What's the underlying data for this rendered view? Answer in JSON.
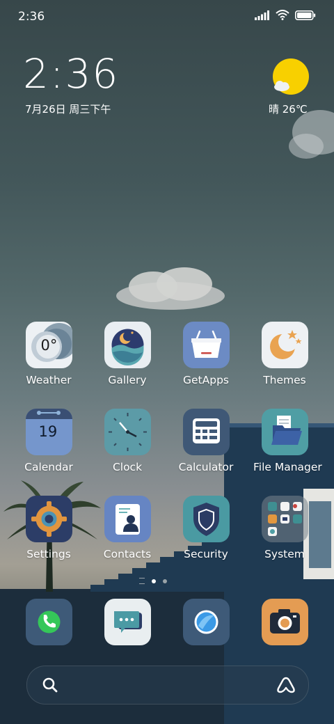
{
  "status_bar": {
    "time": "2:36"
  },
  "widget": {
    "time": "2:36",
    "date": "7月26日 周三下午",
    "weather": "晴 26℃"
  },
  "apps": [
    {
      "label": "Weather",
      "icon": "weather-icon",
      "badge": "0°"
    },
    {
      "label": "Gallery",
      "icon": "gallery-icon"
    },
    {
      "label": "GetApps",
      "icon": "getapps-icon"
    },
    {
      "label": "Themes",
      "icon": "themes-icon"
    },
    {
      "label": "Calendar",
      "icon": "calendar-icon",
      "badge": "19"
    },
    {
      "label": "Clock",
      "icon": "clock-icon"
    },
    {
      "label": "Calculator",
      "icon": "calculator-icon"
    },
    {
      "label": "File Manager",
      "icon": "file-manager-icon"
    },
    {
      "label": "Settings",
      "icon": "settings-icon"
    },
    {
      "label": "Contacts",
      "icon": "contacts-icon"
    },
    {
      "label": "Security",
      "icon": "security-icon"
    },
    {
      "label": "System",
      "icon": "system-folder-icon"
    }
  ],
  "page_indicator": {
    "pages": 2,
    "active": 0
  },
  "dock": [
    {
      "icon": "phone-icon"
    },
    {
      "icon": "messages-icon"
    },
    {
      "icon": "browser-icon"
    },
    {
      "icon": "camera-icon"
    }
  ],
  "search": {
    "left_icon": "search-icon",
    "right_icon": "assistant-icon"
  }
}
